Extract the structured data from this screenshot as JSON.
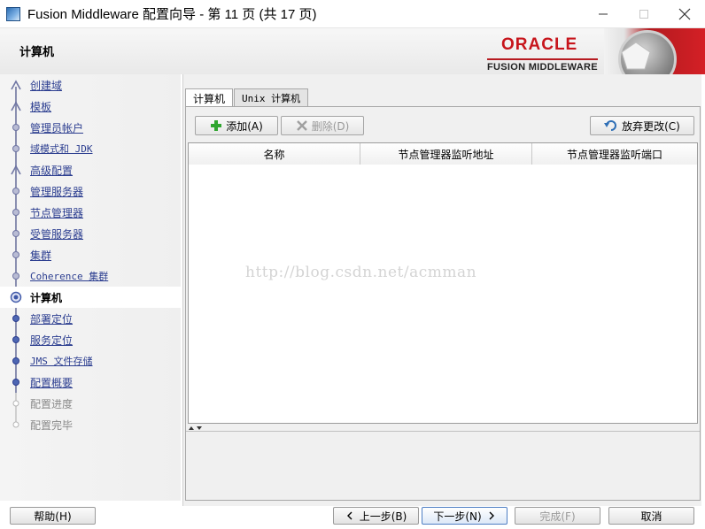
{
  "window": {
    "title": "Fusion Middleware 配置向导 - 第 11 页 (共 17 页)"
  },
  "header": {
    "title": "计算机",
    "brand": "ORACLE",
    "brand_sub": "FUSION MIDDLEWARE",
    "brand_color": "#c7151c"
  },
  "nav": {
    "items": [
      {
        "label": "创建域",
        "state": "done"
      },
      {
        "label": "模板",
        "state": "done"
      },
      {
        "label": "管理员帐户",
        "state": "done"
      },
      {
        "label": "域模式和 JDK",
        "state": "done"
      },
      {
        "label": "高级配置",
        "state": "done"
      },
      {
        "label": "管理服务器",
        "state": "done"
      },
      {
        "label": "节点管理器",
        "state": "done"
      },
      {
        "label": "受管服务器",
        "state": "done"
      },
      {
        "label": "集群",
        "state": "done"
      },
      {
        "label": "Coherence 集群",
        "state": "done"
      },
      {
        "label": "计算机",
        "state": "current"
      },
      {
        "label": "部署定位",
        "state": "todo"
      },
      {
        "label": "服务定位",
        "state": "todo"
      },
      {
        "label": "JMS 文件存储",
        "state": "todo"
      },
      {
        "label": "配置概要",
        "state": "todo"
      },
      {
        "label": "配置进度",
        "state": "disabled"
      },
      {
        "label": "配置完毕",
        "state": "disabled"
      }
    ]
  },
  "tabs": [
    {
      "label": "计算机",
      "selected": true
    },
    {
      "label": "Unix 计算机",
      "selected": false
    }
  ],
  "toolbar": {
    "add_label": "添加(A)",
    "delete_label": "删除(D)",
    "revert_label": "放弃更改(C)"
  },
  "table": {
    "columns": [
      "名称",
      "节点管理器监听地址",
      "节点管理器监听端口"
    ],
    "rows": []
  },
  "watermark": "http://blog.csdn.net/acmman",
  "footer": {
    "help_label": "帮助(H)",
    "back_label": "上一步(B)",
    "next_label": "下一步(N)",
    "finish_label": "完成(F)",
    "cancel_label": "取消"
  }
}
